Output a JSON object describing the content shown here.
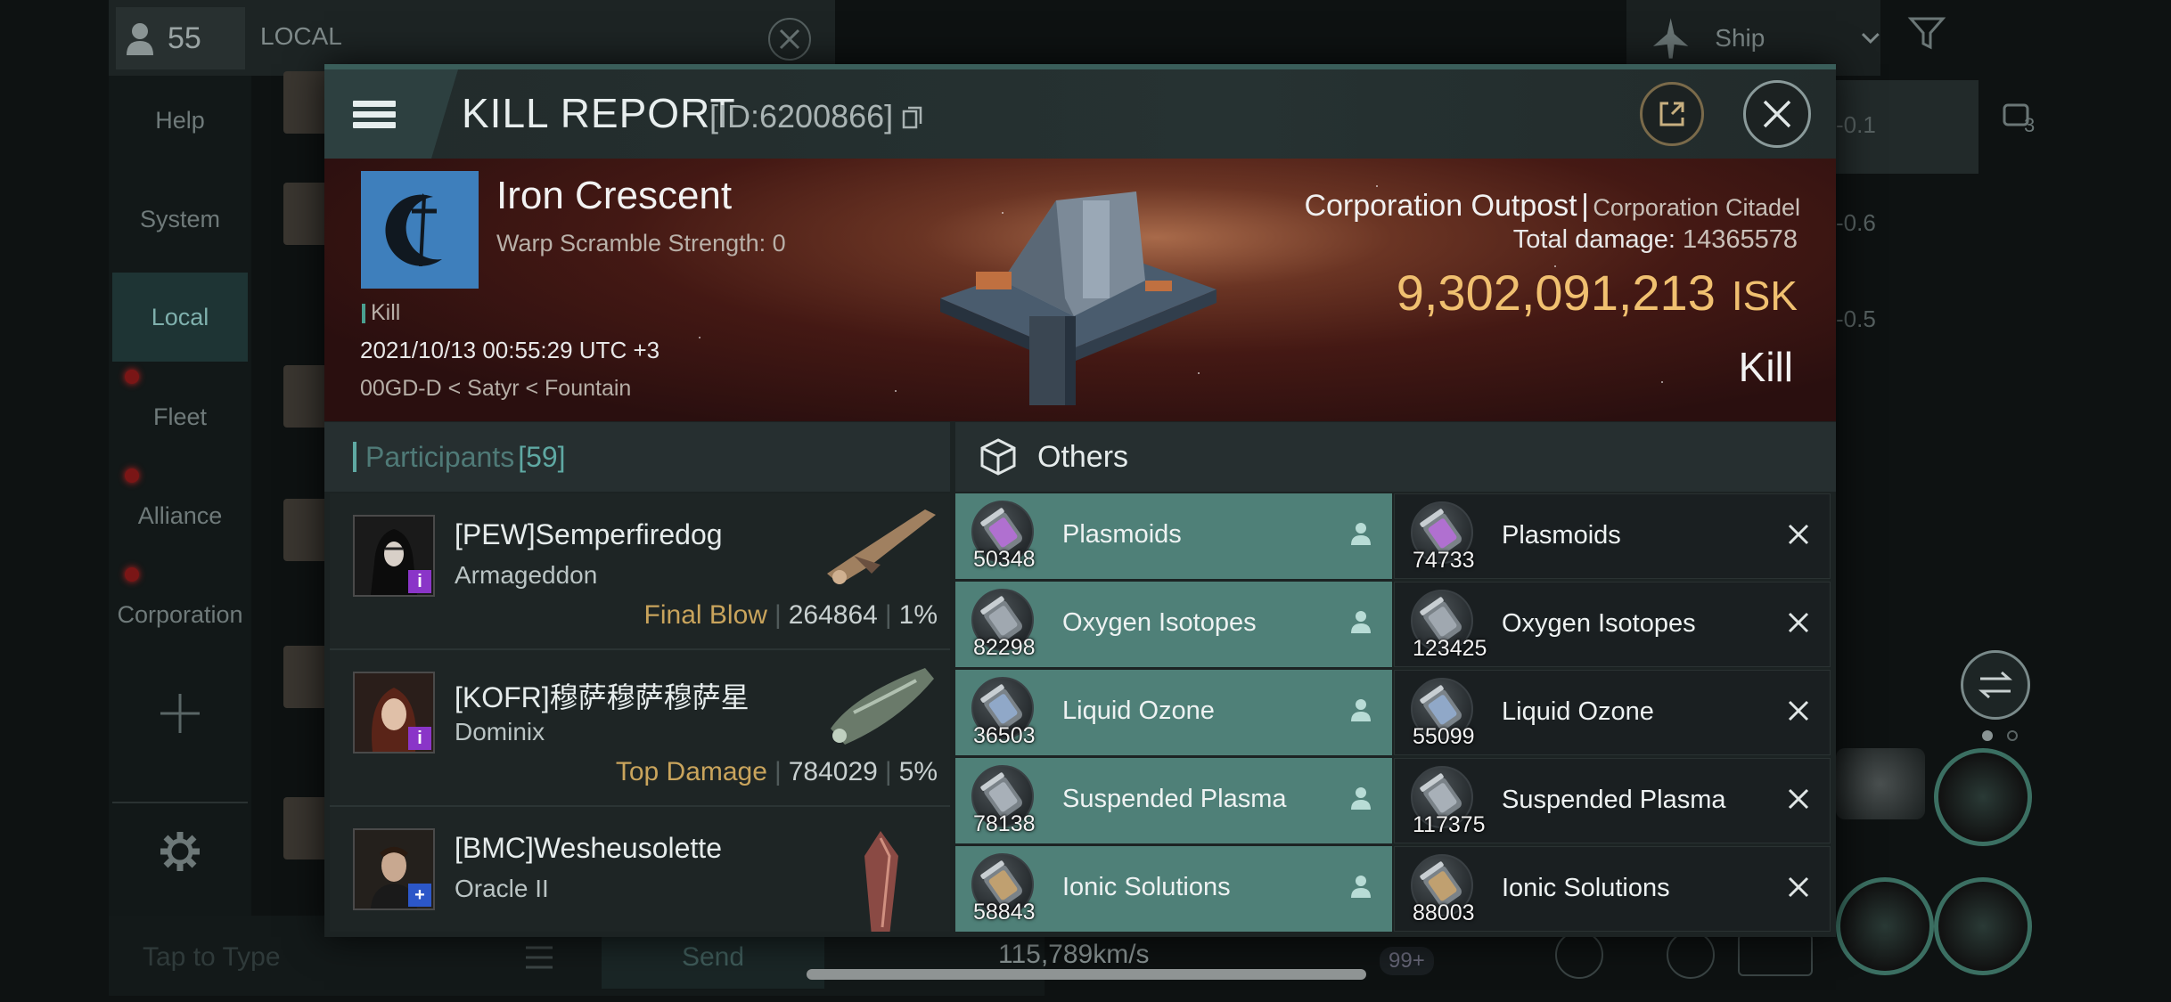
{
  "background": {
    "member_count": "55",
    "channel": "LOCAL",
    "side_menu": [
      "Help",
      "System",
      "Local",
      "Fleet",
      "Alliance",
      "Corporation"
    ],
    "active_side": "Local",
    "ship_selector": "Ship",
    "right_values": [
      "-0.1",
      "-0.6",
      "-0.5"
    ],
    "right_panel_count": "3",
    "chat_placeholder": "Tap to Type",
    "send_label": "Send",
    "speed": "115,789km/s",
    "notif_badge": "99+"
  },
  "report": {
    "title": "KILL REPORT",
    "id": "[ID:6200866]",
    "corp_name": "Iron Crescent",
    "warp_scramble": "Warp Scramble Strength: 0",
    "kill_tag": "Kill",
    "date": "2021/10/13 00:55:29 UTC +3",
    "location": "00GD-D < Satyr < Fountain",
    "ship_name": "Corporation Outpost",
    "ship_sep": "|",
    "ship_class": "Corporation Citadel",
    "total_damage_label": "Total damage:",
    "total_damage": "14365578",
    "isk_value": "9,302,091,213",
    "isk_unit": "ISK",
    "result": "Kill"
  },
  "participants": {
    "label": "Participants",
    "count": "[59]",
    "rows": [
      {
        "name": "[PEW]Semperfiredog",
        "ship": "Armageddon",
        "tag": "Final Blow",
        "damage": "264864",
        "percent": "1%",
        "badge": "i",
        "badge_color": "#8a35c8"
      },
      {
        "name": "[KOFR]穆萨穆萨穆萨星",
        "ship": "Dominix",
        "tag": "Top Damage",
        "damage": "784029",
        "percent": "5%",
        "badge": "i",
        "badge_color": "#8a35c8"
      },
      {
        "name": "[BMC]Wesheusolette",
        "ship": "Oracle II",
        "tag": "",
        "damage": "",
        "percent": "",
        "badge": "+",
        "badge_color": "#2c57c8"
      }
    ]
  },
  "others": {
    "label": "Others",
    "dropped": [
      {
        "name": "Plasmoids",
        "qty": "50348"
      },
      {
        "name": "Oxygen Isotopes",
        "qty": "82298"
      },
      {
        "name": "Liquid Ozone",
        "qty": "36503"
      },
      {
        "name": "Suspended Plasma",
        "qty": "78138"
      },
      {
        "name": "Ionic Solutions",
        "qty": "58843"
      }
    ],
    "destroyed": [
      {
        "name": "Plasmoids",
        "qty": "74733"
      },
      {
        "name": "Oxygen Isotopes",
        "qty": "123425"
      },
      {
        "name": "Liquid Ozone",
        "qty": "55099"
      },
      {
        "name": "Suspended Plasma",
        "qty": "117375"
      },
      {
        "name": "Ionic Solutions",
        "qty": "88003"
      }
    ]
  },
  "colors": {
    "accent": "#5fa9a3",
    "isk": "#f0c070",
    "dropped_bg": "#4f8078",
    "final_blow": "#c9a45c"
  }
}
